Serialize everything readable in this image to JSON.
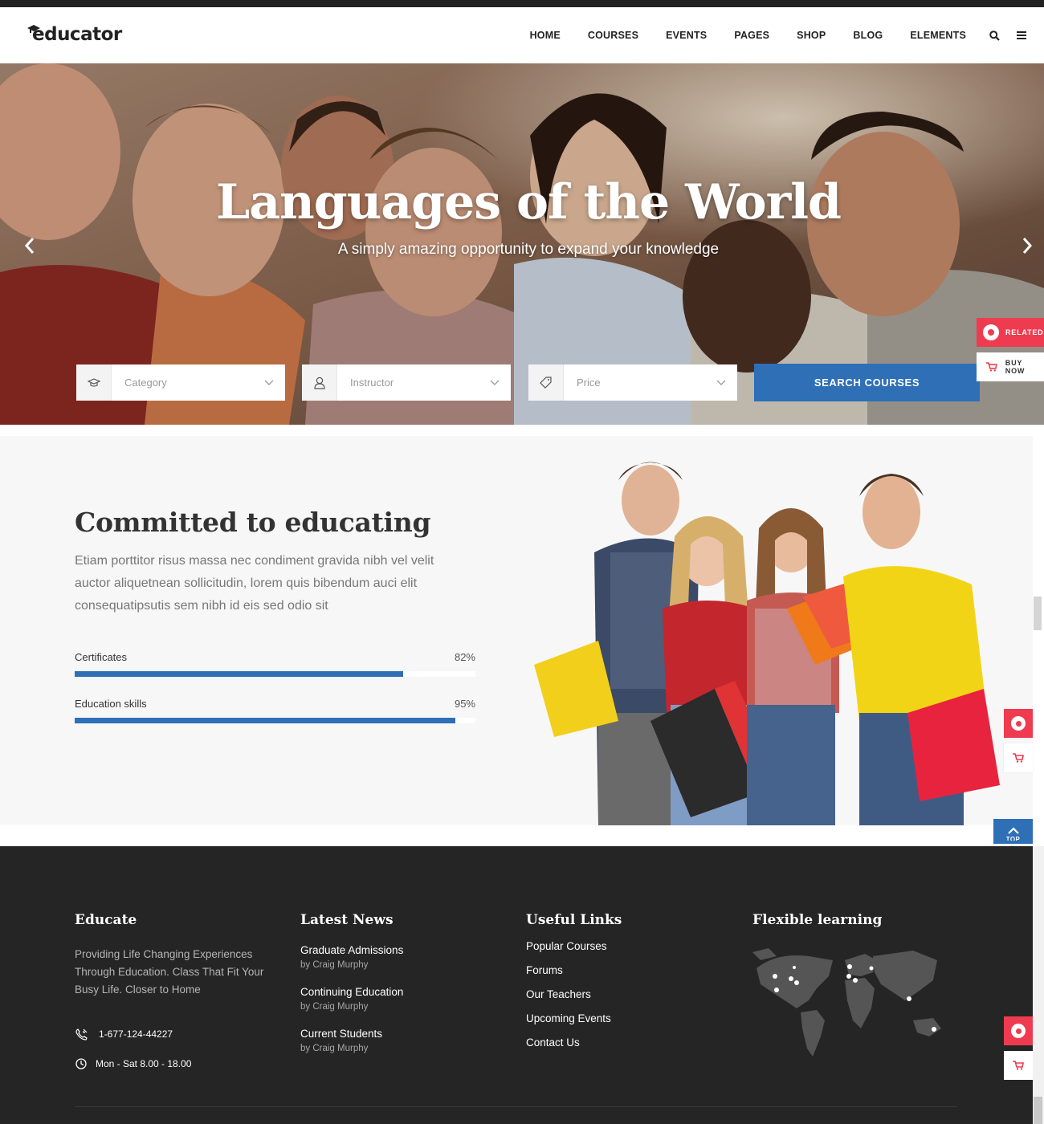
{
  "brand": {
    "logo_text": "educator"
  },
  "nav": {
    "items": [
      "HOME",
      "COURSES",
      "EVENTS",
      "PAGES",
      "SHOP",
      "BLOG",
      "ELEMENTS"
    ],
    "search_icon": "search-icon",
    "menu_icon": "hamburger-menu-icon"
  },
  "hero": {
    "title": "Languages of the World",
    "subtitle": "A simply amazing opportunity to expand your knowledge",
    "search": {
      "category_placeholder": "Category",
      "instructor_placeholder": "Instructor",
      "price_placeholder": "Price",
      "button_label": "SEARCH COURSES"
    }
  },
  "side_tools": {
    "related_label": "RELATED",
    "buy_label": "BUY NOW"
  },
  "committed": {
    "title": "Committed to educating",
    "text": "Etiam porttitor risus massa nec condiment gravida nibh vel velit auctor aliquetnean sollicitudin, lorem quis bibendum auci elit consequatipsutis sem nibh id eis sed odio sit",
    "skills": [
      {
        "label": "Certificates",
        "value_text": "82%",
        "value": 82
      },
      {
        "label": "Education skills",
        "value_text": "95%",
        "value": 95
      }
    ]
  },
  "back_to_top": {
    "label": "TOP"
  },
  "footer": {
    "educate": {
      "heading": "Educate",
      "text": "Providing Life Changing Experiences Through Education. Class That Fit Your Busy Life. Closer to Home",
      "phone": "1-677-124-44227",
      "hours": "Mon - Sat 8.00 - 18.00"
    },
    "news": {
      "heading": "Latest News",
      "items": [
        {
          "title": "Graduate Admissions",
          "by": "by Craig Murphy"
        },
        {
          "title": "Continuing Education",
          "by": "by Craig Murphy"
        },
        {
          "title": "Current Students",
          "by": "by Craig Murphy"
        }
      ]
    },
    "links": {
      "heading": "Useful Links",
      "items": [
        "Popular Courses",
        "Forums",
        "Our Teachers",
        "Upcoming Events",
        "Contact Us"
      ]
    },
    "map": {
      "heading": "Flexible learning"
    }
  },
  "colors": {
    "accent": "#2e6fb6",
    "red": "#ef3b4f",
    "footer_bg": "#252525"
  }
}
